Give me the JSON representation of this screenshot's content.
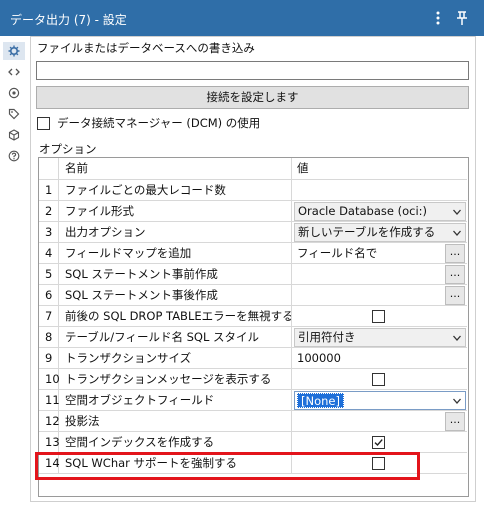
{
  "header": {
    "title": "データ出力 (7) - 設定"
  },
  "rail": {
    "items": [
      {
        "icon": "gear-icon"
      },
      {
        "icon": "code-icon"
      },
      {
        "icon": "target-icon"
      },
      {
        "icon": "tag-icon"
      },
      {
        "icon": "cube-icon"
      },
      {
        "icon": "help-icon"
      }
    ]
  },
  "form": {
    "target_label": "ファイルまたはデータベースへの書き込み",
    "target_value": "",
    "connect_button": "接続を設定します",
    "dcm_label": "データ接続マネージャー (DCM) の使用",
    "dcm_checked": false,
    "options_label": "オプション"
  },
  "grid": {
    "col_name": "名前",
    "col_value": "値",
    "rows": [
      {
        "num": "1",
        "name": "ファイルごとの最大レコード数",
        "type": "text",
        "value": ""
      },
      {
        "num": "2",
        "name": "ファイル形式",
        "type": "dropdown",
        "value": "Oracle Database (oci:)"
      },
      {
        "num": "3",
        "name": "出力オプション",
        "type": "dropdown",
        "value": "新しいテーブルを作成する"
      },
      {
        "num": "4",
        "name": "フィールドマップを追加",
        "type": "ellipsis",
        "value": "フィールド名で"
      },
      {
        "num": "5",
        "name": "SQL ステートメント事前作成",
        "type": "ellipsis",
        "value": ""
      },
      {
        "num": "6",
        "name": "SQL ステートメント事後作成",
        "type": "ellipsis",
        "value": ""
      },
      {
        "num": "7",
        "name": "前後の SQL DROP TABLEエラーを無視する",
        "type": "checkbox",
        "checked": false
      },
      {
        "num": "8",
        "name": "テーブル/フィールド名 SQL スタイル",
        "type": "dropdown",
        "value": "引用符付き"
      },
      {
        "num": "9",
        "name": "トランザクションサイズ",
        "type": "text",
        "value": "100000"
      },
      {
        "num": "10",
        "name": "トランザクションメッセージを表示する",
        "type": "checkbox",
        "checked": false
      },
      {
        "num": "11",
        "name": "空間オブジェクトフィールド",
        "type": "dropdown-selected",
        "value": "[None]"
      },
      {
        "num": "12",
        "name": "投影法",
        "type": "ellipsis",
        "value": ""
      },
      {
        "num": "13",
        "name": "空間インデックスを作成する",
        "type": "checkbox",
        "checked": true
      },
      {
        "num": "14",
        "name": "SQL WChar サポートを強制する",
        "type": "checkbox",
        "checked": false
      }
    ]
  },
  "colors": {
    "header_bg": "#2f6ea8",
    "highlight": "#e3141b",
    "selection": "#1e6fd9"
  }
}
